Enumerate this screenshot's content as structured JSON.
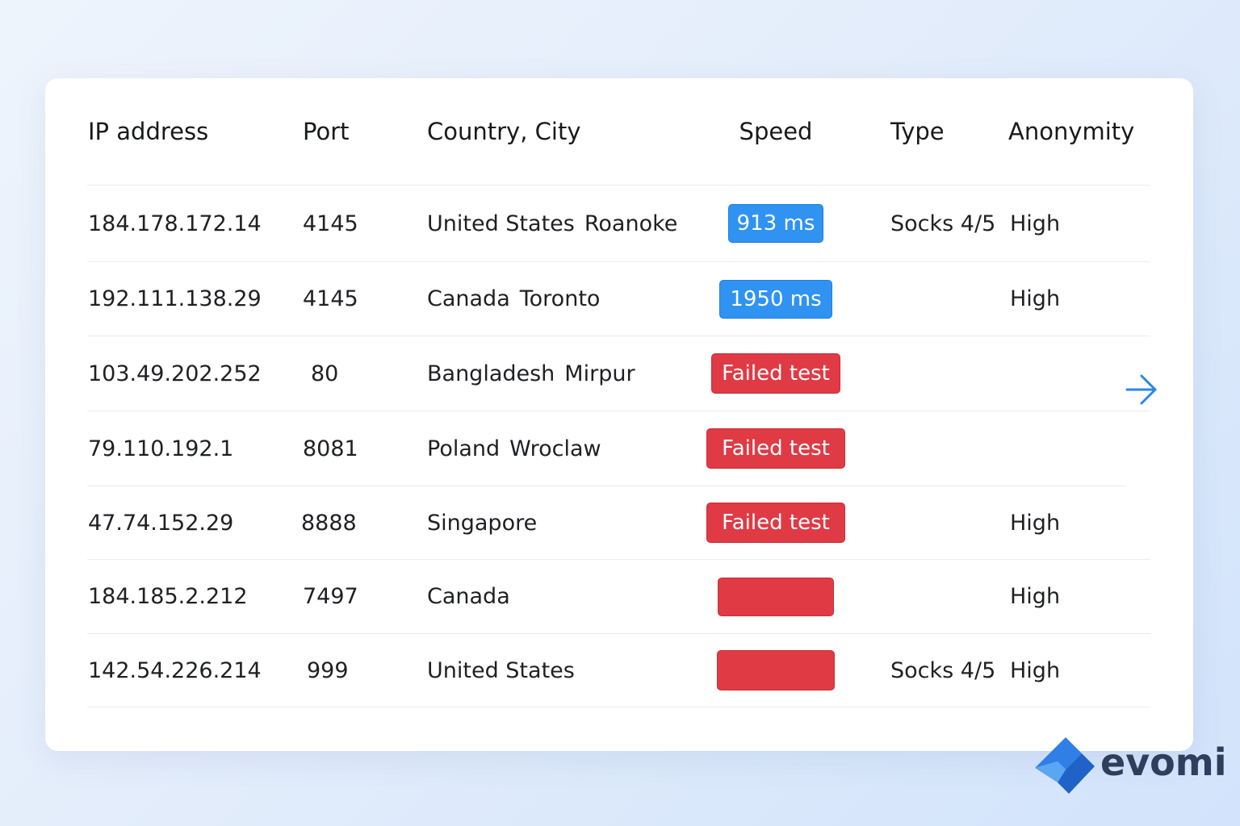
{
  "table": {
    "headers": {
      "ip": "IP address",
      "port": "Port",
      "location": "Country, City",
      "speed": "Speed",
      "type": "Type",
      "anonymity": "Anonymity"
    },
    "rows": [
      {
        "ip": "184.178.172.14",
        "port": "4145",
        "country": "United States",
        "city": "Roanoke",
        "speed": "913 ms",
        "speed_status": "ok",
        "type": "Socks 4/5",
        "anonymity": "High"
      },
      {
        "ip": "192.111.138.29",
        "port": "4145",
        "country": "Canada",
        "city": "Toronto",
        "speed": "1950 ms",
        "speed_status": "ok",
        "type": "",
        "anonymity": "High"
      },
      {
        "ip": "103.49.202.252",
        "port": "80",
        "country": "Bangladesh",
        "city": "Mirpur",
        "speed": "Failed test",
        "speed_status": "failed",
        "type": "",
        "anonymity": ""
      },
      {
        "ip": "79.110.192.1",
        "port": "8081",
        "country": "Poland",
        "city": "Wroclaw",
        "speed": "Failed test",
        "speed_status": "failed",
        "type": "",
        "anonymity": ""
      },
      {
        "ip": "47.74.152.29",
        "port": "8888",
        "country": "Singapore",
        "city": "",
        "speed": "Failed test",
        "speed_status": "failed",
        "type": "",
        "anonymity": "High"
      },
      {
        "ip": "184.185.2.212",
        "port": "7497",
        "country": "Canada",
        "city": "",
        "speed": "",
        "speed_status": "failed",
        "type": "",
        "anonymity": "High"
      },
      {
        "ip": "142.54.226.214",
        "port": "999",
        "country": "United States",
        "city": "",
        "speed": "",
        "speed_status": "failed",
        "type": "Socks 4/5",
        "anonymity": "High"
      }
    ]
  },
  "navigation": {
    "next_icon": "arrow-right-icon"
  },
  "brand": {
    "name": "evomi",
    "logo_icon": "evomi-logo-icon"
  },
  "colors": {
    "speed_ok": "#3093f2",
    "speed_failed": "#e03a45",
    "arrow": "#2a86e8",
    "brand_text": "#2d3f5c"
  }
}
